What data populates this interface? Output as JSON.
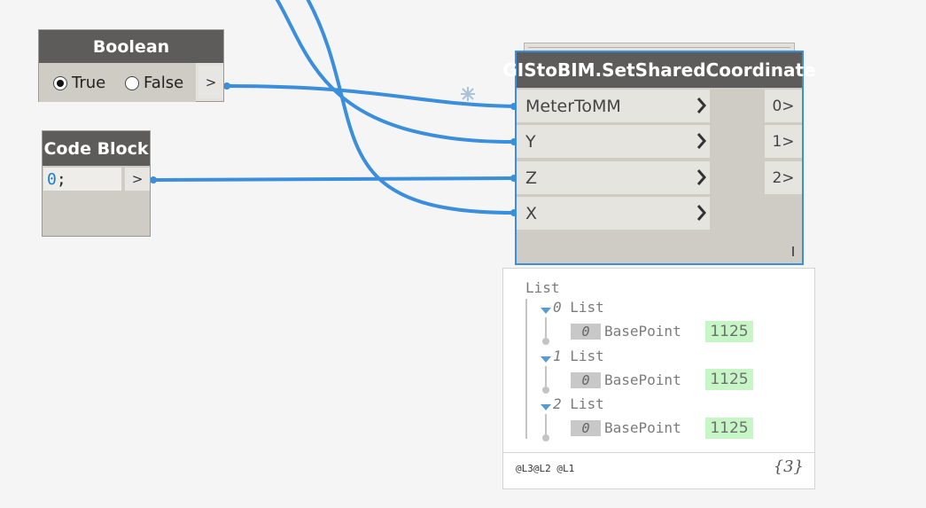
{
  "colors": {
    "wire": "#3a8edb",
    "node_header": "#5e5c5a",
    "selected_border": "#3a8edb",
    "value_bg": "#c6f6c6"
  },
  "boolean_node": {
    "title": "Boolean",
    "options": [
      {
        "label": "True",
        "selected": true
      },
      {
        "label": "False",
        "selected": false
      }
    ],
    "output_label": ">"
  },
  "code_block_node": {
    "title": "Code Block",
    "code_value": "0",
    "code_terminator": ";",
    "output_label": ">"
  },
  "main_node": {
    "title": "GIStoBIM.SetSharedCoordinate",
    "inputs": [
      "MeterToMM",
      "Y",
      "Z",
      "X"
    ],
    "outputs": [
      "0>",
      "1>",
      "2>"
    ],
    "lacing_mark": "I"
  },
  "preview": {
    "root_label": "List",
    "sublists": [
      {
        "index": "0",
        "label": "List",
        "item_index": "0",
        "item_label": "BasePoint",
        "item_value": "1125"
      },
      {
        "index": "1",
        "label": "List",
        "item_index": "0",
        "item_label": "BasePoint",
        "item_value": "1125"
      },
      {
        "index": "2",
        "label": "List",
        "item_index": "0",
        "item_label": "BasePoint",
        "item_value": "1125"
      }
    ],
    "levels": "@L3@L2 @L1",
    "count": "{3}"
  }
}
